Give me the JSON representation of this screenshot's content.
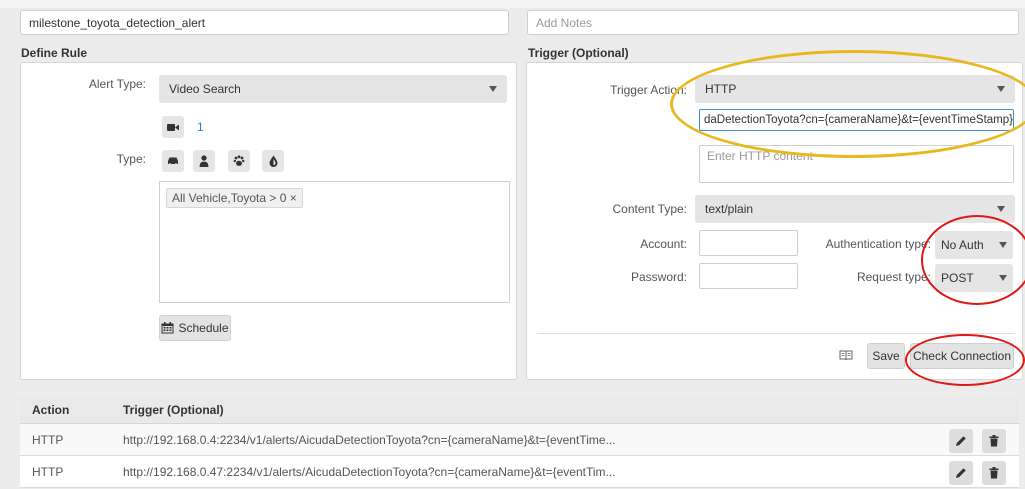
{
  "rule_name": {
    "value": "milestone_toyota_detection_alert"
  },
  "notes": {
    "placeholder": "Add Notes"
  },
  "define_rule": {
    "title": "Define Rule",
    "alert_type_label": "Alert Type:",
    "alert_type_value": "Video Search",
    "camera_count": "1",
    "type_label": "Type:",
    "type_icons": [
      "car-icon",
      "person-icon",
      "paw-icon",
      "drop-icon"
    ],
    "tag_text": "All Vehicle,Toyota > 0 ×",
    "schedule_label": "Schedule"
  },
  "trigger": {
    "title": "Trigger (Optional)",
    "action_label": "Trigger Action:",
    "action_value": "HTTP",
    "url_value": "daDetectionToyota?cn={cameraName}&t={eventTimeStamp}",
    "content_placeholder": "Enter HTTP content",
    "content_type_label": "Content Type:",
    "content_type_value": "text/plain",
    "account_label": "Account:",
    "password_label": "Password:",
    "auth_type_label": "Authentication type:",
    "auth_type_value": "No Auth",
    "request_type_label": "Request type:",
    "request_type_value": "POST",
    "save_label": "Save",
    "check_label": "Check Connection"
  },
  "table": {
    "headers": [
      "Action",
      "Trigger (Optional)"
    ],
    "rows": [
      {
        "action": "HTTP",
        "trigger": "http://192.168.0.4:2234/v1/alerts/AicudaDetectionToyota?cn={cameraName}&t={eventTime..."
      },
      {
        "action": "HTTP",
        "trigger": "http://192.168.0.47:2234/v1/alerts/AicudaDetectionToyota?cn={cameraName}&t={eventTim..."
      }
    ]
  },
  "colors": {
    "highlight_yellow": "#e9b820",
    "highlight_red": "#e01818",
    "url_border": "#3c8fd0",
    "camera_blue": "#3c78c8"
  }
}
